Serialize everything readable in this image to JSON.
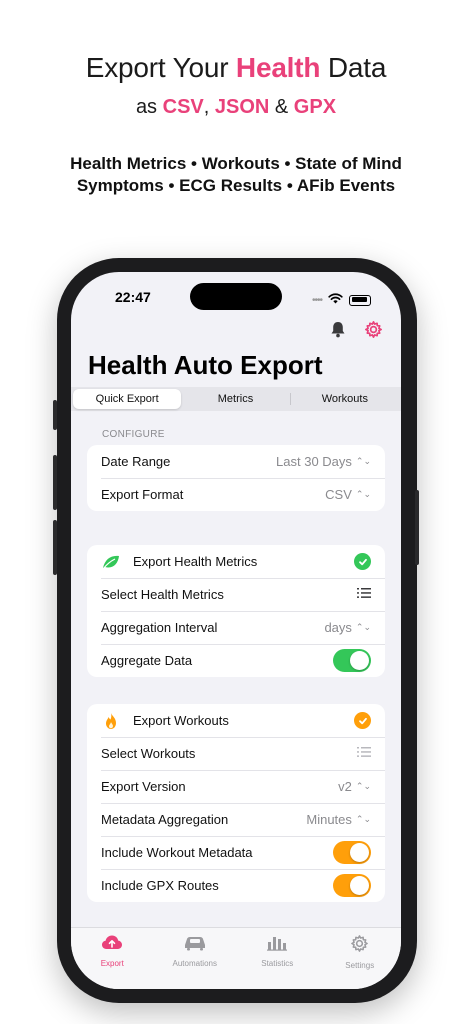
{
  "headline": {
    "pre": "Export Your ",
    "highlight": "Health",
    "post": " Data"
  },
  "subline": {
    "pre": "as ",
    "csv": "CSV",
    "comma": ",",
    "json": "JSON",
    "amp": " & ",
    "gpx": "GPX"
  },
  "features": {
    "line1": "Health Metrics • Workouts • State of Mind",
    "line2": "Symptoms • ECG Results • AFib Events"
  },
  "status": {
    "time": "22:47"
  },
  "app": {
    "title": "Health Auto Export"
  },
  "segments": [
    "Quick Export",
    "Metrics",
    "Workouts"
  ],
  "configure": {
    "section_label": "CONFIGURE",
    "date_range": {
      "label": "Date Range",
      "value": "Last 30 Days"
    },
    "export_format": {
      "label": "Export Format",
      "value": "CSV"
    }
  },
  "health_metrics": {
    "header": "Export Health Metrics",
    "select": "Select Health Metrics",
    "aggregation_interval": {
      "label": "Aggregation Interval",
      "value": "days"
    },
    "aggregate_data": {
      "label": "Aggregate Data",
      "on": true
    }
  },
  "workouts": {
    "header": "Export Workouts",
    "select": "Select Workouts",
    "export_version": {
      "label": "Export Version",
      "value": "v2"
    },
    "metadata_aggregation": {
      "label": "Metadata Aggregation",
      "value": "Minutes"
    },
    "include_metadata": {
      "label": "Include Workout Metadata",
      "on": true
    },
    "include_gpx": {
      "label": "Include GPX Routes",
      "on": true
    }
  },
  "tabbar": {
    "export": "Export",
    "automations": "Automations",
    "statistics": "Statistics",
    "settings": "Settings"
  },
  "colors": {
    "accent": "#e9417a",
    "green": "#34c759",
    "orange": "#ff9f0a"
  },
  "icons": {
    "bell": "bell-icon",
    "gear": "gear-icon",
    "leaf": "leaf-icon",
    "flame": "flame-icon",
    "list": "list-icon",
    "cloud_upload": "cloud-upload-icon",
    "car": "car-icon",
    "bar_chart": "bar-chart-icon",
    "settings": "settings-gear-icon"
  }
}
